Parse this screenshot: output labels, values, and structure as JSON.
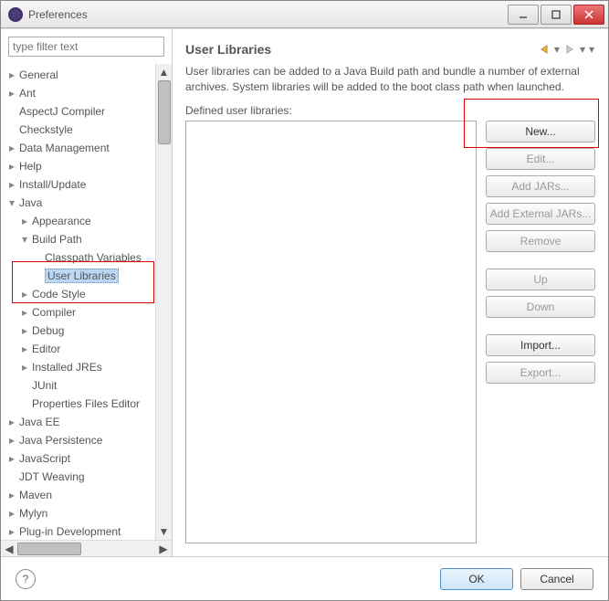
{
  "titlebar": {
    "title": "Preferences"
  },
  "filter": {
    "placeholder": "type filter text"
  },
  "tree": {
    "items": [
      {
        "label": "General",
        "indent": 0,
        "twisty": "closed"
      },
      {
        "label": "Ant",
        "indent": 0,
        "twisty": "closed"
      },
      {
        "label": "AspectJ Compiler",
        "indent": 0,
        "twisty": "none"
      },
      {
        "label": "Checkstyle",
        "indent": 0,
        "twisty": "none"
      },
      {
        "label": "Data Management",
        "indent": 0,
        "twisty": "closed"
      },
      {
        "label": "Help",
        "indent": 0,
        "twisty": "closed"
      },
      {
        "label": "Install/Update",
        "indent": 0,
        "twisty": "closed"
      },
      {
        "label": "Java",
        "indent": 0,
        "twisty": "open"
      },
      {
        "label": "Appearance",
        "indent": 1,
        "twisty": "closed"
      },
      {
        "label": "Build Path",
        "indent": 1,
        "twisty": "open"
      },
      {
        "label": "Classpath Variables",
        "indent": 2,
        "twisty": "none"
      },
      {
        "label": "User Libraries",
        "indent": 2,
        "twisty": "none",
        "selected": true
      },
      {
        "label": "Code Style",
        "indent": 1,
        "twisty": "closed"
      },
      {
        "label": "Compiler",
        "indent": 1,
        "twisty": "closed"
      },
      {
        "label": "Debug",
        "indent": 1,
        "twisty": "closed"
      },
      {
        "label": "Editor",
        "indent": 1,
        "twisty": "closed"
      },
      {
        "label": "Installed JREs",
        "indent": 1,
        "twisty": "closed"
      },
      {
        "label": "JUnit",
        "indent": 1,
        "twisty": "none"
      },
      {
        "label": "Properties Files Editor",
        "indent": 1,
        "twisty": "none"
      },
      {
        "label": "Java EE",
        "indent": 0,
        "twisty": "closed"
      },
      {
        "label": "Java Persistence",
        "indent": 0,
        "twisty": "closed"
      },
      {
        "label": "JavaScript",
        "indent": 0,
        "twisty": "closed"
      },
      {
        "label": "JDT Weaving",
        "indent": 0,
        "twisty": "none"
      },
      {
        "label": "Maven",
        "indent": 0,
        "twisty": "closed"
      },
      {
        "label": "Mylyn",
        "indent": 0,
        "twisty": "closed"
      },
      {
        "label": "Plug-in Development",
        "indent": 0,
        "twisty": "closed"
      }
    ]
  },
  "panel": {
    "title": "User Libraries",
    "description": "User libraries can be added to a Java Build path and bundle a number of external archives. System libraries will be added to the boot class path when launched.",
    "list_label": "Defined user libraries:"
  },
  "buttons": {
    "new": "New...",
    "edit": "Edit...",
    "add_jars": "Add JARs...",
    "add_ext_jars": "Add External JARs...",
    "remove": "Remove",
    "up": "Up",
    "down": "Down",
    "import": "Import...",
    "export": "Export..."
  },
  "footer": {
    "help": "?",
    "ok": "OK",
    "cancel": "Cancel"
  }
}
